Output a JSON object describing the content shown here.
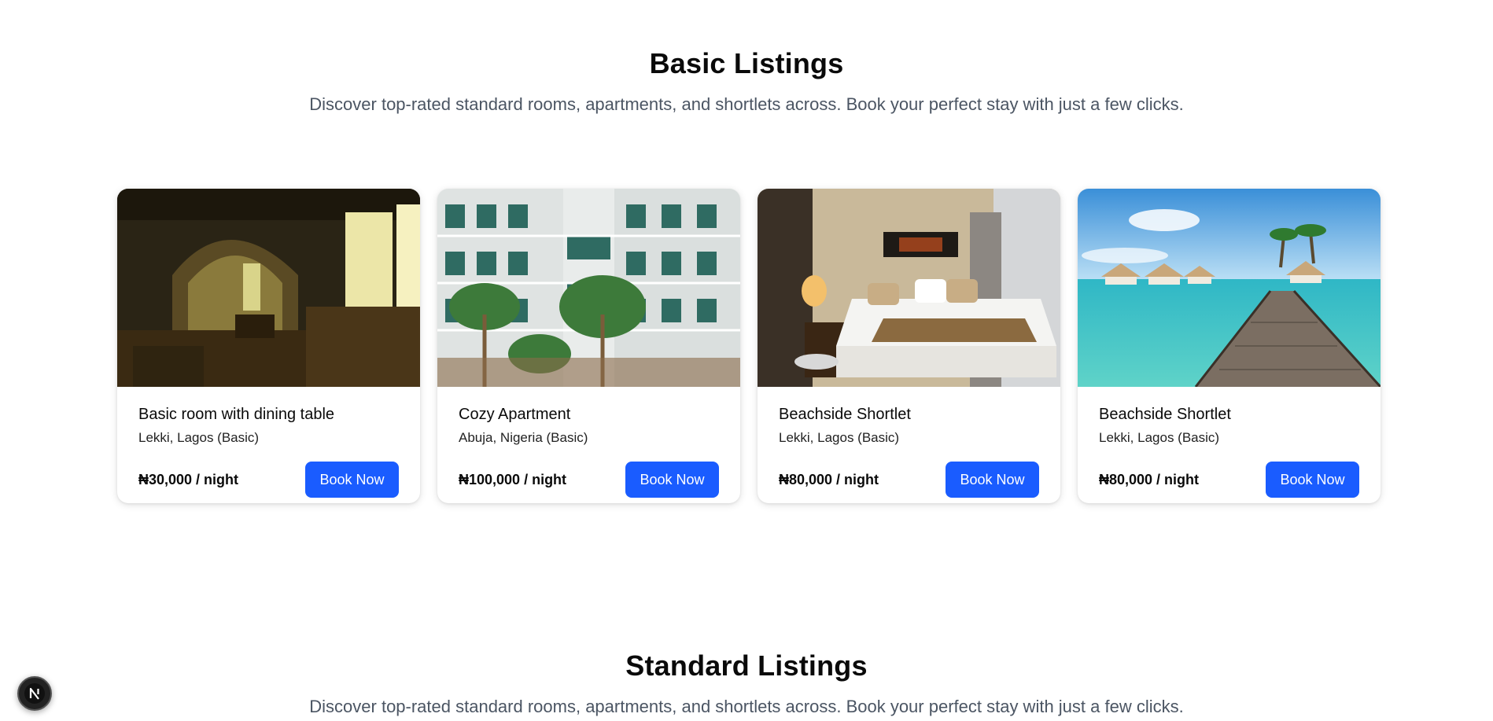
{
  "basic": {
    "title": "Basic Listings",
    "subtitle": "Discover top-rated standard rooms, apartments, and shortlets across. Book your perfect stay with just a few clicks.",
    "listings": [
      {
        "title": "Basic room with dining table",
        "location": "Lekki, Lagos (Basic)",
        "price": "₦30,000 / night",
        "button": "Book Now",
        "image": "dim-room-photo"
      },
      {
        "title": "Cozy Apartment",
        "location": "Abuja, Nigeria (Basic)",
        "price": "₦100,000 / night",
        "button": "Book Now",
        "image": "hotel-courtyard-photo"
      },
      {
        "title": "Beachside Shortlet",
        "location": "Lekki, Lagos (Basic)",
        "price": "₦80,000 / night",
        "button": "Book Now",
        "image": "hotel-bedroom-photo"
      },
      {
        "title": "Beachside Shortlet",
        "location": "Lekki, Lagos (Basic)",
        "price": "₦80,000 / night",
        "button": "Book Now",
        "image": "overwater-villas-photo"
      }
    ]
  },
  "standard": {
    "title": "Standard Listings",
    "subtitle": "Discover top-rated standard rooms, apartments, and shortlets across. Book your perfect stay with just a few clicks."
  },
  "badge": {
    "letter": "N",
    "icon": "nextjs-logo-icon"
  },
  "colors": {
    "accent": "#1a5cff",
    "subtitle": "#4b5563"
  }
}
